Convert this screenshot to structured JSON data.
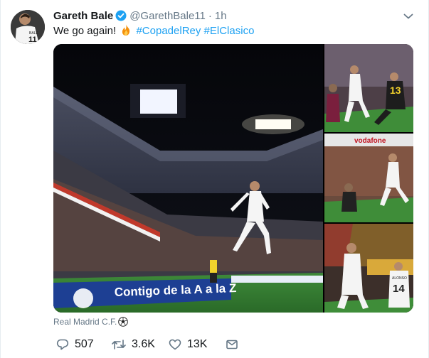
{
  "tweet": {
    "author_name": "Gareth Bale",
    "author_handle": "@GarethBale11",
    "separator": "·",
    "time": "1h",
    "text_prefix": "We go again!",
    "hashtags": [
      "#CopadelRey",
      "#ElClasico"
    ],
    "avatar_jersey_number": "11",
    "avatar_jersey_name": "BALE"
  },
  "media": {
    "main_banner_text": "Contigo de la A a la Z",
    "side_jersey_number_1": "13",
    "side_jersey_number_3": "14",
    "side_jersey_name_3": "ALONSO",
    "side_banner_text_2": "vodafone"
  },
  "attribution": {
    "label": "Real Madrid C.F."
  },
  "actions": {
    "reply_count": "507",
    "retweet_count": "3.6K",
    "like_count": "13K"
  },
  "colors": {
    "link": "#1da1f2",
    "secondary_text": "#657786",
    "primary_text": "#14171a",
    "verified": "#1da1f2"
  },
  "icons": [
    "verified-icon",
    "chevron-down-icon",
    "fire-emoji-icon",
    "soccer-ball-emoji-icon",
    "reply-icon",
    "retweet-icon",
    "like-icon",
    "direct-message-icon"
  ]
}
